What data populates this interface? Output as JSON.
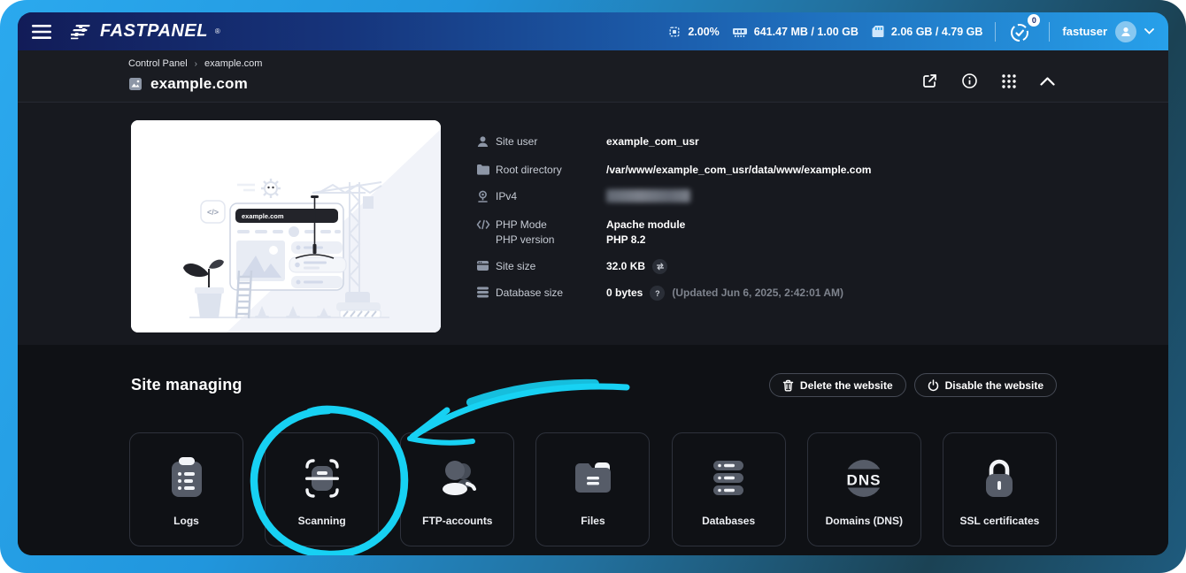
{
  "colors": {
    "annotation": "#17D1F3",
    "frame_blue": "#2BA9EE",
    "header_blue": "#2196F3",
    "accent_dark": "#15171C"
  },
  "topbar": {
    "brand": "FASTPANEL",
    "brand_reg": "®",
    "cpu": "2.00%",
    "ram": "641.47 MB / 1.00 GB",
    "disk": "2.06 GB / 4.79 GB",
    "notifications_badge": "0",
    "username": "fastuser"
  },
  "breadcrumb": {
    "items": [
      "Control Panel",
      "example.com"
    ]
  },
  "page": {
    "title": "example.com"
  },
  "illustration": {
    "address": "example.com"
  },
  "site_info": {
    "rows": [
      {
        "icon": "user-icon",
        "label": "Site user",
        "value": "example_com_usr"
      },
      {
        "icon": "folder-icon",
        "label": "Root directory",
        "value": "/var/www/example_com_usr/data/www/example.com"
      },
      {
        "icon": "pin-icon",
        "label": "IPv4",
        "value": ""
      },
      {
        "icon": "code-icon",
        "label": "PHP Mode",
        "value": "Apache module",
        "label2": "PHP version",
        "value2": "PHP 8.2"
      },
      {
        "icon": "browser-icon",
        "label": "Site size",
        "value": "32.0 KB"
      },
      {
        "icon": "database-icon",
        "label": "Database size",
        "value": "0 bytes",
        "help": "?",
        "note": "(Updated Jun 6, 2025, 2:42:01 AM)"
      }
    ]
  },
  "managing": {
    "title": "Site managing",
    "delete_button": "Delete the website",
    "disable_button": "Disable the website",
    "cards": [
      {
        "icon": "logs-icon",
        "label": "Logs"
      },
      {
        "icon": "scanning-icon",
        "label": "Scanning"
      },
      {
        "icon": "ftp-accounts-icon",
        "label": "FTP-accounts"
      },
      {
        "icon": "files-icon",
        "label": "Files"
      },
      {
        "icon": "databases-icon",
        "label": "Databases"
      },
      {
        "icon": "dns-icon",
        "label": "Domains (DNS)"
      },
      {
        "icon": "ssl-certificates-icon",
        "label": "SSL certificates"
      }
    ]
  }
}
